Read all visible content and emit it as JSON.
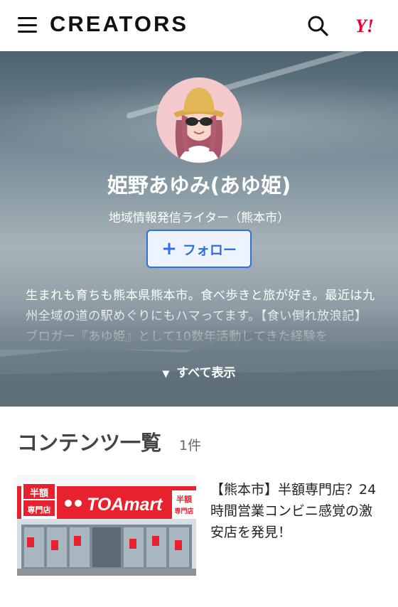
{
  "header": {
    "brand": "CREATORS",
    "yahoo_logo": "Y!",
    "menu_icon": "hamburger-icon",
    "search_icon": "search-icon"
  },
  "profile": {
    "name": "姫野あゆみ(あゆ姫)",
    "role": "地域情報発信ライター（熊本市）",
    "follow_label": "フォロー",
    "bio": "生まれも育ちも熊本県熊本市。食べ歩きと旅が好き。最近は九州全域の道の駅めぐりにもハマってます。【食い倒れ放浪記】ブロガー『あゆ姫』として10数年活動してきた経験を",
    "expand_label": "すべて表示"
  },
  "contents": {
    "title": "コンテンツ一覧",
    "count": "1件",
    "items": [
      {
        "title": "【熊本市】半額専門店？24時間営業コンビニ感覚の激安店を発見！",
        "thumb_sign_left_top": "半額",
        "thumb_sign_left_bottom": "専門店",
        "thumb_sign_main": "TOAmart",
        "thumb_sign_right_top": "半額",
        "thumb_sign_right_bottom": "専門店"
      }
    ]
  },
  "colors": {
    "accent": "#2f6fde",
    "yahoo_red": "#e60033",
    "store_red": "#e8212e"
  }
}
